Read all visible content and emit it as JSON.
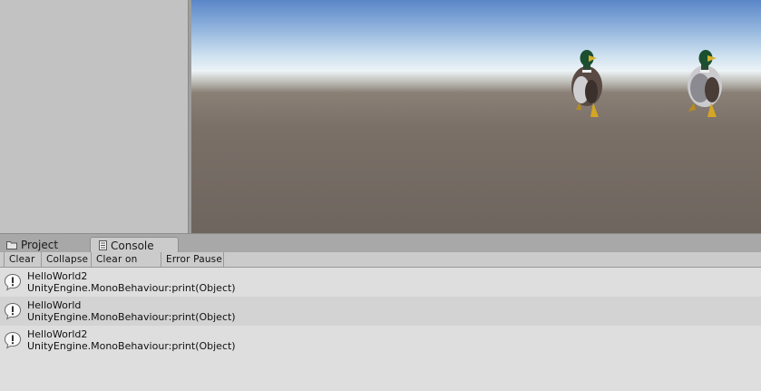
{
  "tabs": [
    {
      "label": "Project",
      "icon": "folder-icon",
      "active": false
    },
    {
      "label": "Console",
      "icon": "console-icon",
      "active": true
    }
  ],
  "console_toolbar": {
    "clear_label": "Clear",
    "collapse_label": "Collapse",
    "clear_on_play_label": "Clear on Play",
    "error_pause_label": "Error Pause"
  },
  "console_entries": [
    {
      "message": "HelloWorld2",
      "stack": "UnityEngine.MonoBehaviour:print(Object)",
      "icon": "info-message-icon"
    },
    {
      "message": "HelloWorld",
      "stack": "UnityEngine.MonoBehaviour:print(Object)",
      "icon": "info-message-icon"
    },
    {
      "message": "HelloWorld2",
      "stack": "UnityEngine.MonoBehaviour:print(Object)",
      "icon": "info-message-icon"
    }
  ],
  "colors": {
    "panel_bg": "#c2c2c2",
    "console_bg": "#dedede",
    "console_row_alt": "#d3d3d3",
    "sky_top": "#5a86c8",
    "ground": "#6e655e"
  }
}
